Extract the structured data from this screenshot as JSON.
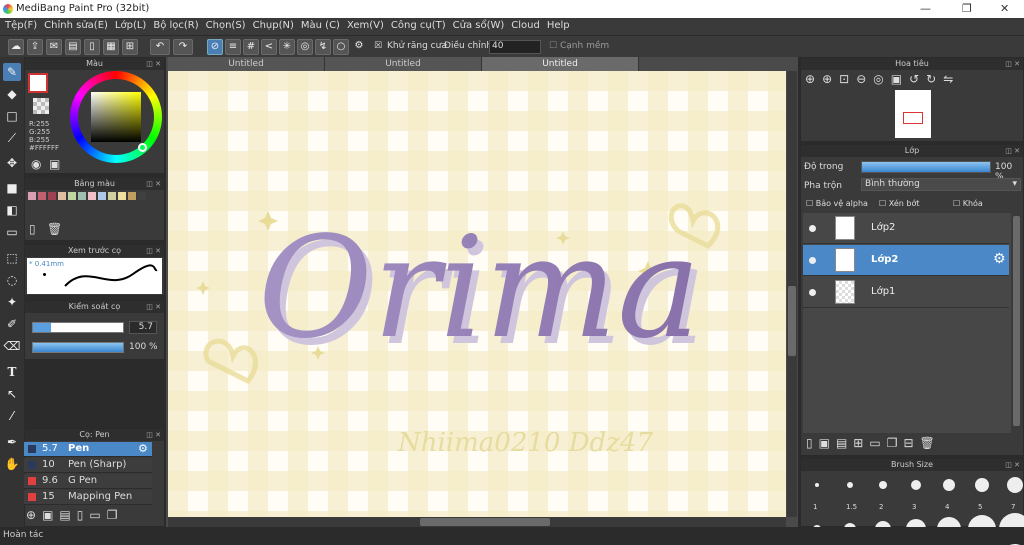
{
  "window": {
    "title": "MediBang Paint Pro (32bit)"
  },
  "menu": [
    "Tệp(F)",
    "Chỉnh sửa(E)",
    "Lớp(L)",
    "Bộ lọc(R)",
    "Chọn(S)",
    "Chụp(N)",
    "Màu (C)",
    "Xem(V)",
    "Công cụ(T)",
    "Cửa sổ(W)",
    "Cloud",
    "Help"
  ],
  "toolbar": {
    "antialias_label": "Khử răng cưa",
    "adjust_label": "Điều chỉnh",
    "adjust_value": "40",
    "snap_label": "Cạnh mềm"
  },
  "tabs": [
    "Untitled",
    "Untitled",
    "Untitled"
  ],
  "color_panel": {
    "title": "Màu",
    "r": "R:255",
    "g": "G:255",
    "b": "B:255",
    "hex": "#FFFFFF"
  },
  "palette_panel": {
    "title": "Bảng màu",
    "colors": [
      "#d8a0b0",
      "#c06070",
      "#a04050",
      "#e0c0a0",
      "#c0d8a0",
      "#a0c0b0",
      "#f0c0c8",
      "#b0c8e8",
      "#d0d0a0",
      "#f0e0a0",
      "#c0a060",
      "#404040"
    ]
  },
  "preview_panel": {
    "title": "Xem trước cọ",
    "size": "0.41mm"
  },
  "control_panel": {
    "title": "Kiểm soát cọ",
    "size_value": "5.7",
    "opacity_value": "100 %",
    "size_fraction": 0.2,
    "opacity_fraction": 1.0
  },
  "brush_panel": {
    "title": "Cọ: Pen",
    "items": [
      {
        "size": "5.7",
        "name": "Pen",
        "color": "#2a3a5a"
      },
      {
        "size": "10",
        "name": "Pen (Sharp)",
        "color": "#2a3a5a"
      },
      {
        "size": "9.6",
        "name": "G Pen",
        "color": "#e04040"
      },
      {
        "size": "15",
        "name": "Mapping Pen",
        "color": "#e04040"
      }
    ]
  },
  "navigator": {
    "title": "Hoa tiêu"
  },
  "layer_panel": {
    "title": "Lớp",
    "opacity_label": "Độ trong",
    "opacity_value": "100 %",
    "opacity_fraction": 1.0,
    "blend_label": "Pha trộn",
    "blend_value": "Bình thường",
    "alpha_label": "Bảo vệ alpha",
    "clip_label": "Xén bớt",
    "lock_label": "Khóa",
    "layers": [
      {
        "name": "Lớp2"
      },
      {
        "name": "Lớp2"
      },
      {
        "name": "Lớp1"
      }
    ]
  },
  "brush_size_panel": {
    "title": "Brush Size",
    "sizes": [
      "1",
      "1.5",
      "2",
      "3",
      "4",
      "5",
      "7"
    ]
  },
  "status": {
    "text": "Hoàn tác"
  },
  "canvas": {
    "lettering": "Orima",
    "signature": "Nhiima0210 Ddz47"
  }
}
